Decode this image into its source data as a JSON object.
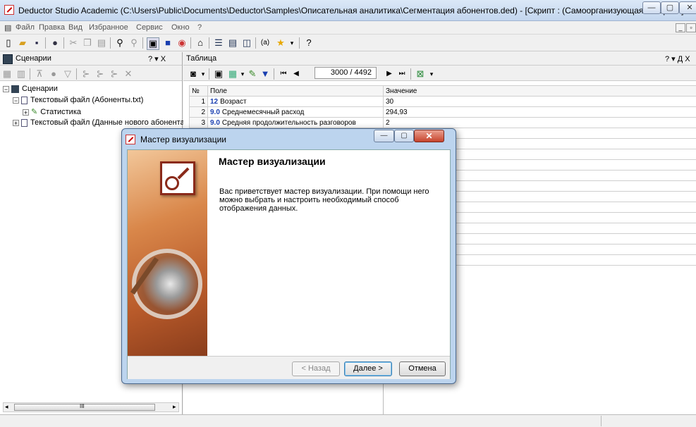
{
  "window": {
    "title": "Deductor Studio Academic (C:\\Users\\Public\\Documents\\Deductor\\Samples\\Описательная аналитика\\Сегментация абонентов.ded) - [Скрипт : (Самоорганизующаяся карта -]"
  },
  "menu": [
    "Файл",
    "Правка",
    "Вид",
    "Избранное",
    "Сервис",
    "Окно",
    "?"
  ],
  "left_pane": {
    "title": "Сценарии",
    "controls": "? ▾ X",
    "tree": [
      {
        "label": "Сценарии"
      },
      {
        "label": "Текстовый файл (Абоненты.txt)"
      },
      {
        "label": "Статистика"
      },
      {
        "label": "Текстовый файл (Данные нового абонента"
      }
    ],
    "scroll_mid": "III"
  },
  "right_pane": {
    "title": "Таблица",
    "controls": "? ▾ Д X",
    "record_counter": "3000 / 4492",
    "columns": [
      "№",
      "Поле",
      "Значение"
    ],
    "rows": [
      {
        "num": "1",
        "code": "12",
        "field": "Возраст",
        "value": "30"
      },
      {
        "num": "2",
        "code": "9.0",
        "field": "Среднемесячный расход",
        "value": "294,93"
      },
      {
        "num": "3",
        "code": "9.0",
        "field": "Средняя продолжительность разговоров",
        "value": "2"
      }
    ],
    "partial_value": "ая"
  },
  "dialog": {
    "title": "Мастер визуализации",
    "heading": "Мастер визуализации",
    "body": "Вас приветствует мастер визуализации. При помощи него можно выбрать и настроить необходимый способ отображения данных.",
    "buttons": {
      "back": "< Назад",
      "next": "Далее >",
      "cancel": "Отмена"
    }
  },
  "colors": {
    "accent": "#1a3fb0",
    "close": "#c7442d",
    "wizard": "#d9874a"
  }
}
